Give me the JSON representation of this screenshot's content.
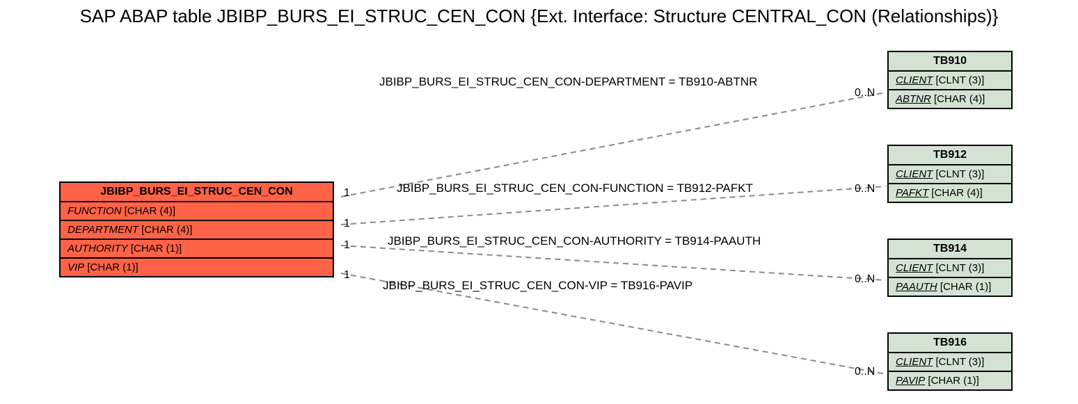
{
  "title": "SAP ABAP table JBIBP_BURS_EI_STRUC_CEN_CON {Ext. Interface: Structure CENTRAL_CON (Relationships)}",
  "main_entity": {
    "name": "JBIBP_BURS_EI_STRUC_CEN_CON",
    "fields": [
      {
        "name": "FUNCTION",
        "type": "[CHAR (4)]"
      },
      {
        "name": "DEPARTMENT",
        "type": "[CHAR (4)]"
      },
      {
        "name": "AUTHORITY",
        "type": "[CHAR (1)]"
      },
      {
        "name": "VIP",
        "type": "[CHAR (1)]"
      }
    ]
  },
  "targets": [
    {
      "name": "TB910",
      "fields": [
        {
          "name": "CLIENT",
          "type": "[CLNT (3)]",
          "underline": true
        },
        {
          "name": "ABTNR",
          "type": "[CHAR (4)]",
          "underline": true
        }
      ]
    },
    {
      "name": "TB912",
      "fields": [
        {
          "name": "CLIENT",
          "type": "[CLNT (3)]",
          "underline": true
        },
        {
          "name": "PAFKT",
          "type": "[CHAR (4)]",
          "underline": true
        }
      ]
    },
    {
      "name": "TB914",
      "fields": [
        {
          "name": "CLIENT",
          "type": "[CLNT (3)]",
          "underline": true
        },
        {
          "name": "PAAUTH",
          "type": "[CHAR (1)]",
          "underline": true
        }
      ]
    },
    {
      "name": "TB916",
      "fields": [
        {
          "name": "CLIENT",
          "type": "[CLNT (3)]",
          "underline": true
        },
        {
          "name": "PAVIP",
          "type": "[CHAR (1)]",
          "underline": true
        }
      ]
    }
  ],
  "relationships": [
    {
      "label": "JBIBP_BURS_EI_STRUC_CEN_CON-DEPARTMENT = TB910-ABTNR",
      "left_card": "1",
      "right_card": "0..N"
    },
    {
      "label": "JBIBP_BURS_EI_STRUC_CEN_CON-FUNCTION = TB912-PAFKT",
      "left_card": "1",
      "right_card": "0..N"
    },
    {
      "label": "JBIBP_BURS_EI_STRUC_CEN_CON-AUTHORITY = TB914-PAAUTH",
      "left_card": "1",
      "right_card": "0..N"
    },
    {
      "label": "JBIBP_BURS_EI_STRUC_CEN_CON-VIP = TB916-PAVIP",
      "left_card": "1",
      "right_card": "0..N"
    }
  ]
}
